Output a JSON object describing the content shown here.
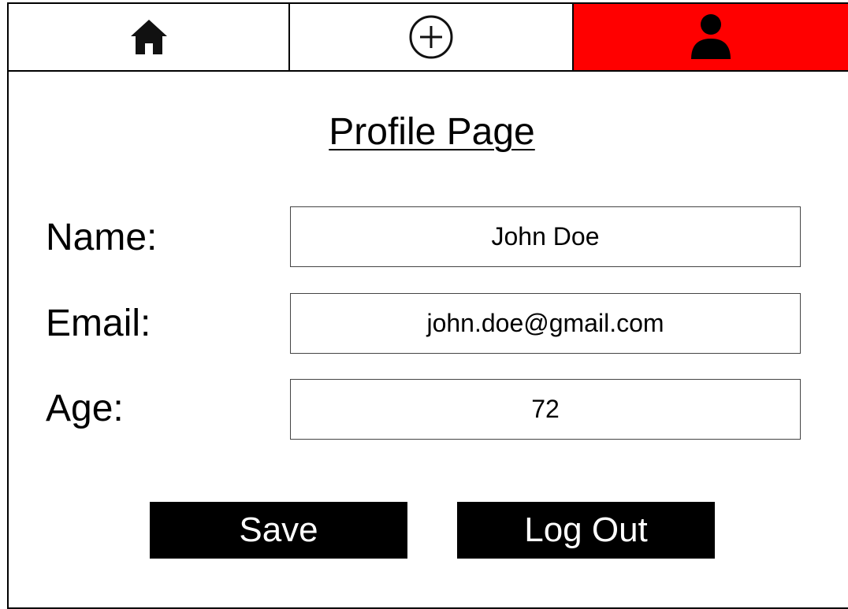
{
  "nav": {
    "tabs": [
      {
        "icon": "home-icon",
        "active": false
      },
      {
        "icon": "add-circle-icon",
        "active": false
      },
      {
        "icon": "user-profile-icon",
        "active": true
      }
    ],
    "active_color": "#ff0000"
  },
  "page": {
    "title": "Profile Page"
  },
  "form": {
    "name_label": "Name:",
    "name_value": "John Doe",
    "email_label": "Email:",
    "email_value": "john.doe@gmail.com",
    "age_label": "Age:",
    "age_value": "72"
  },
  "actions": {
    "save_label": "Save",
    "logout_label": "Log Out"
  }
}
